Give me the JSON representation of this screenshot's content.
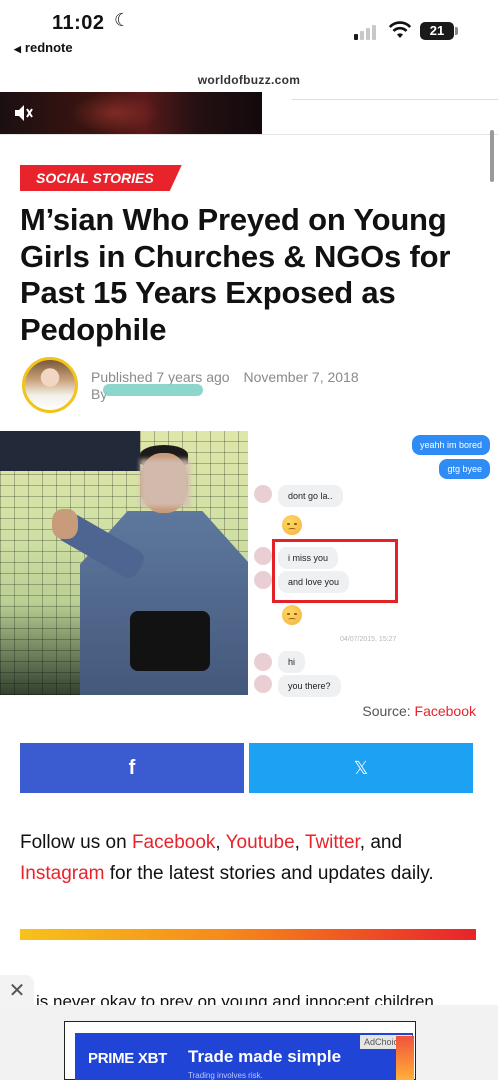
{
  "status_bar": {
    "time": "11:02",
    "back_app": "rednote",
    "battery": "21"
  },
  "browser": {
    "url": "worldofbuzz.com"
  },
  "article": {
    "category": "SOCIAL STORIES",
    "title": "M’sian Who Preyed on Young Girls in Churches & NGOs for Past 15 Years Exposed as Pedophile",
    "published_prefix": "Published",
    "published_relative": "7 years ago",
    "published_date": "November 7, 2018",
    "by_label": "By",
    "source_label": "Source:",
    "source_link": "Facebook",
    "follow": {
      "prefix": "Follow us on ",
      "links": [
        "Facebook",
        "Youtube",
        "Twitter",
        "Instagram"
      ],
      "and": ", and",
      "suffix": " for the latest stories and updates daily."
    },
    "next_paragraph": "is never okay to prey on young and innocent children"
  },
  "chat": {
    "outgoing": [
      "yeahh im bored",
      "gtg byee"
    ],
    "incoming": [
      "dont go la..",
      "i miss you",
      "and love you",
      "hi",
      "you there?"
    ],
    "timestamp": "04/07/2015, 15:27"
  },
  "share": {
    "facebook_label": "f",
    "x_label": "𝕏"
  },
  "ad": {
    "close_label": "✕",
    "brand": "PRIME XBT",
    "headline": "Trade made simple",
    "subtext": "Trading involves risk.",
    "badge": "AdChoices"
  },
  "colors": {
    "accent_red": "#e8232b",
    "facebook_blue": "#3b5bd0",
    "x_blue": "#1da1f2"
  }
}
